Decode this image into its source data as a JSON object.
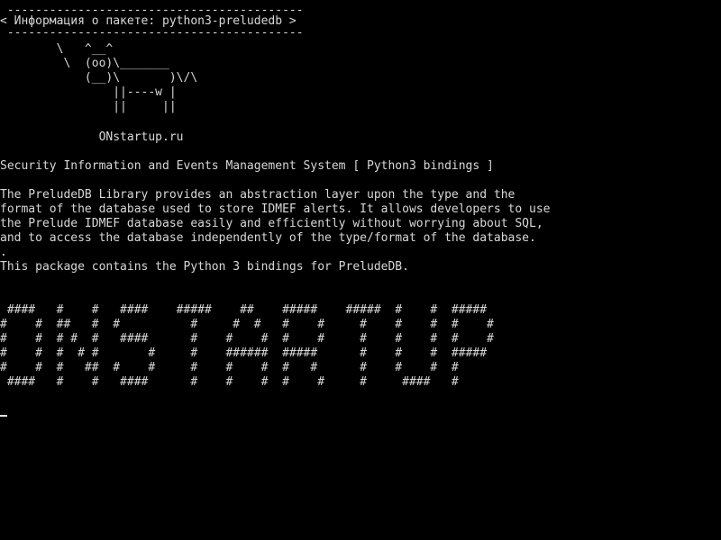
{
  "terminal": {
    "colors": {
      "background": "#000000",
      "foreground": "#d8d8d8"
    },
    "cowsay": {
      "border_top": " ------------------------------------------",
      "message": "< Информация о пакете: python3-preludedb >",
      "border_bottom": " ------------------------------------------",
      "cow": [
        "        \\   ^__^",
        "         \\  (oo)\\_______",
        "            (__)\\       )\\/\\",
        "                ||----w |",
        "                ||     ||"
      ]
    },
    "site": "              ONstartup.ru",
    "summary": "Security Information and Events Management System [ Python3 bindings ]",
    "description": [
      "The PreludeDB Library provides an abstraction layer upon the type and the",
      "format of the database used to store IDMEF alerts. It allows developers to use",
      "the Prelude IDMEF database easily and efficiently without worrying about SQL,",
      "and to access the database independently of the type/format of the database.",
      ".",
      "This package contains the Python 3 bindings for PreludeDB."
    ],
    "banner": [
      " ####   #    #   ####    #####    ##    #####    #####  #    #  #####",
      "#    #  ##   #  #          #     #  #   #    #     #    #    #  #    #",
      "#    #  # #  #   ####      #    #    #  #    #     #    #    #  #    #",
      "#    #  #  # #       #     #    ######  #####      #    #    #  #####",
      "#    #  #   ##  #    #     #    #    #  #   #      #    #    #  #",
      " ####   #    #   ####      #    #    #  #    #     #     ####   #"
    ]
  }
}
